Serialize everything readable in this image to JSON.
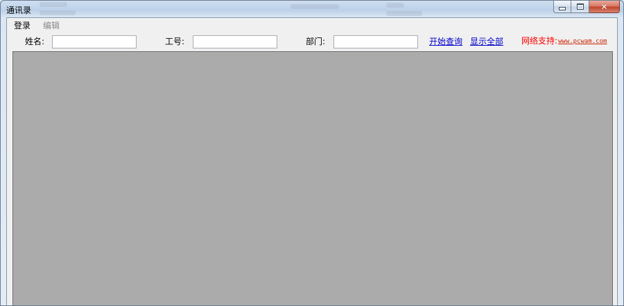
{
  "window": {
    "title": "通讯录",
    "controls": {
      "minimize_icon": "minimize-icon",
      "maximize_icon": "maximize-icon",
      "close_icon": "close-icon"
    }
  },
  "menu": {
    "items": [
      {
        "label": "登录",
        "enabled": true
      },
      {
        "label": "编辑",
        "enabled": false
      }
    ]
  },
  "search": {
    "name_label": "姓名:",
    "name_value": "",
    "id_label": "工号:",
    "id_value": "",
    "dept_label": "部门:",
    "dept_value": "",
    "query_link": "开始查询",
    "show_all_link": "显示全部",
    "support_label": "网络支持:",
    "support_url": "www.pcwam.com"
  },
  "colors": {
    "grid_background": "#ababab",
    "link": "#0000cc",
    "support_text": "#ff0000"
  }
}
